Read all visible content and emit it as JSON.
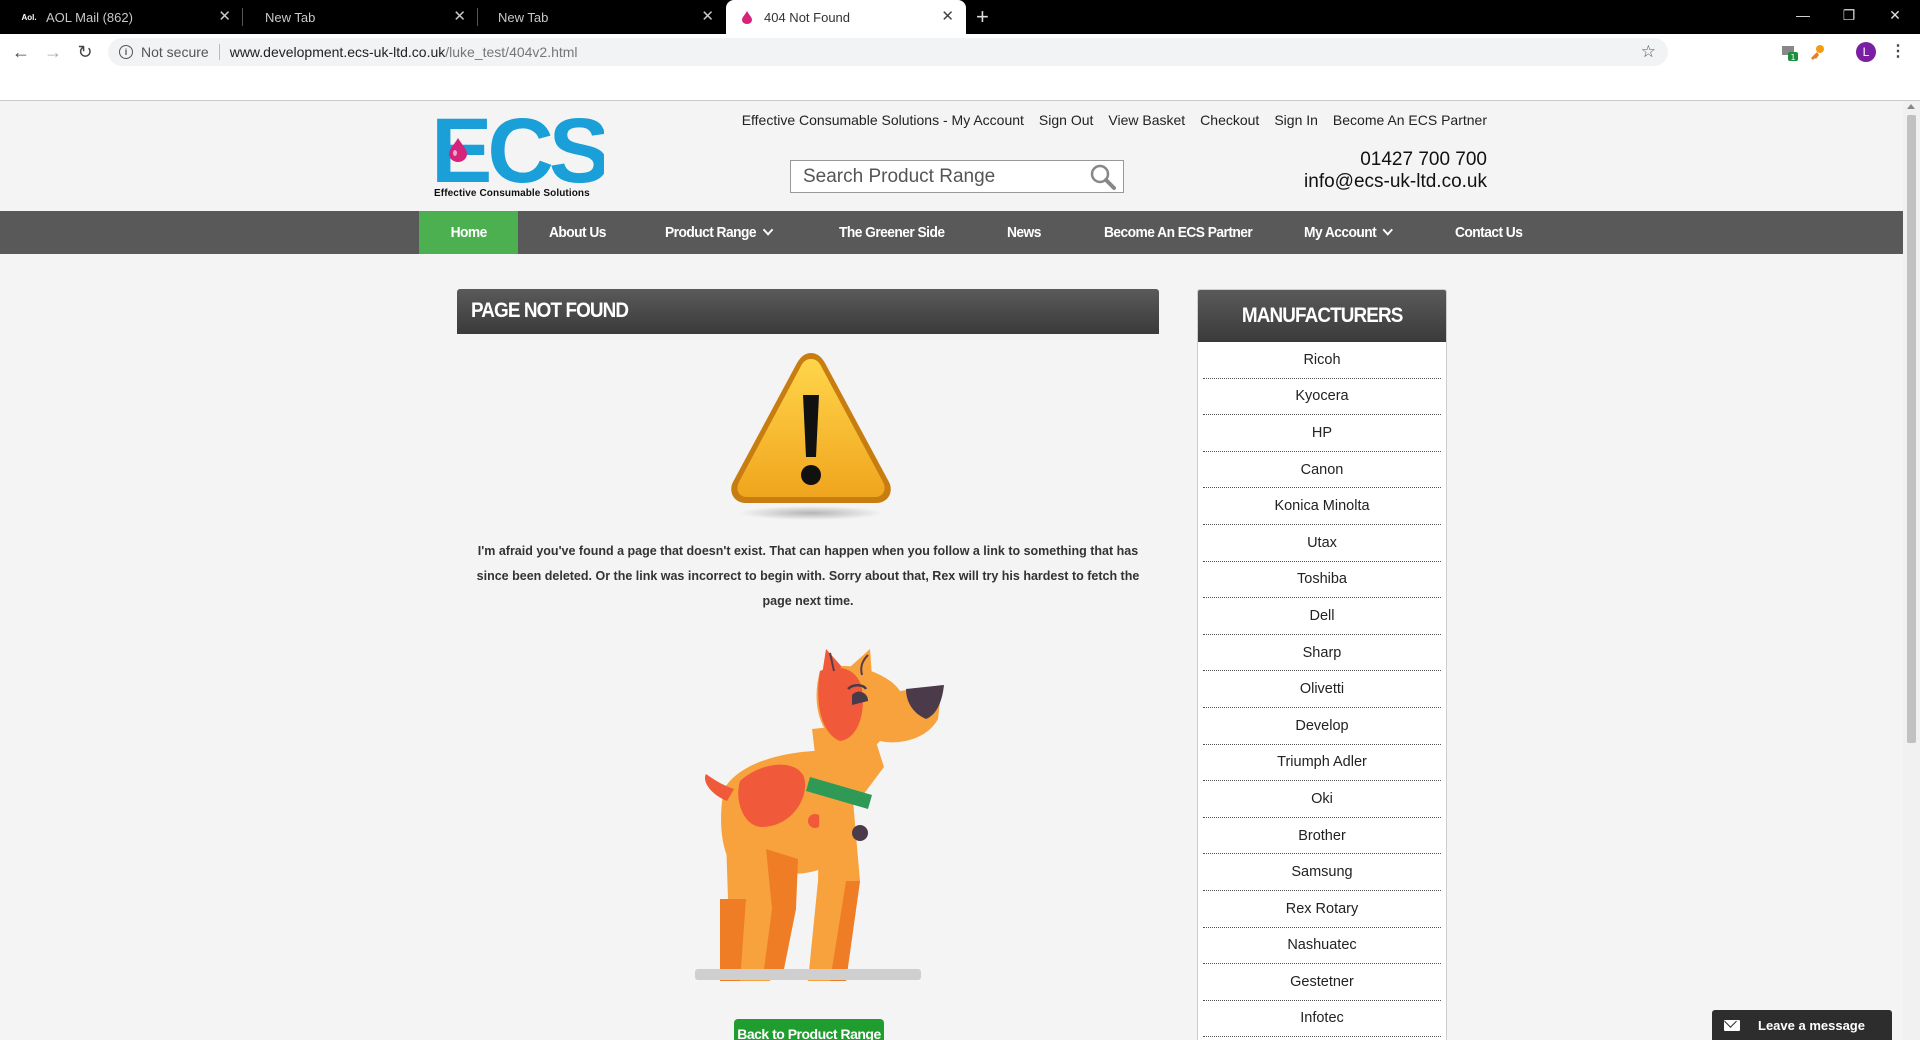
{
  "browser": {
    "tabs": [
      {
        "title": "AOL Mail (862)",
        "favicon": "aol-icon",
        "favicon_text": "Aol."
      },
      {
        "title": "New Tab"
      },
      {
        "title": "New Tab"
      },
      {
        "title": "404 Not Found",
        "favicon": "ecs-drop-icon"
      }
    ],
    "new_tab_symbol": "+",
    "security_label": "Not secure",
    "url_host": "www.development.ecs-uk-ltd.co.uk",
    "url_path": "/luke_test/404v2.html",
    "extension_badge": "1",
    "profile_initial": "L"
  },
  "header": {
    "logo_text": "ECS",
    "logo_tagline": "Effective Consumable Solutions",
    "top_links": [
      "Effective Consumable Solutions - My Account",
      "Sign Out",
      "View Basket",
      "Checkout",
      "Sign In",
      "Become An ECS Partner"
    ],
    "search_placeholder": "Search Product Range",
    "phone": "01427 700 700",
    "email": "info@ecs-uk-ltd.co.uk"
  },
  "nav": {
    "items": [
      {
        "label": "Home",
        "active": true
      },
      {
        "label": "About Us"
      },
      {
        "label": "Product Range",
        "dropdown": true
      },
      {
        "label": "The Greener Side"
      },
      {
        "label": "News"
      },
      {
        "label": "Become An ECS Partner"
      },
      {
        "label": "My Account",
        "dropdown": true
      },
      {
        "label": "Contact Us"
      }
    ]
  },
  "main": {
    "title": "PAGE NOT FOUND",
    "message": "I'm afraid you've found a page that doesn't exist. That can happen when you follow a link to something that has since been deleted. Or the link was incorrect to begin with. Sorry about that, Rex will try his hardest to fetch the page next time.",
    "back_button": "Back to Product Range"
  },
  "sidebar": {
    "title": "MANUFACTURERS",
    "manufacturers": [
      "Ricoh",
      "Kyocera",
      "HP",
      "Canon",
      "Konica Minolta",
      "Utax",
      "Toshiba",
      "Dell",
      "Sharp",
      "Olivetti",
      "Develop",
      "Triumph Adler",
      "Oki",
      "Brother",
      "Samsung",
      "Rex Rotary",
      "Nashuatec",
      "Gestetner",
      "Infotec"
    ]
  },
  "chat": {
    "label": "Leave a message"
  },
  "colors": {
    "brand_blue": "#1a9fd8",
    "nav_active": "#4caf50",
    "nav_bg": "#595959",
    "button_green": "#1f9d2f"
  }
}
